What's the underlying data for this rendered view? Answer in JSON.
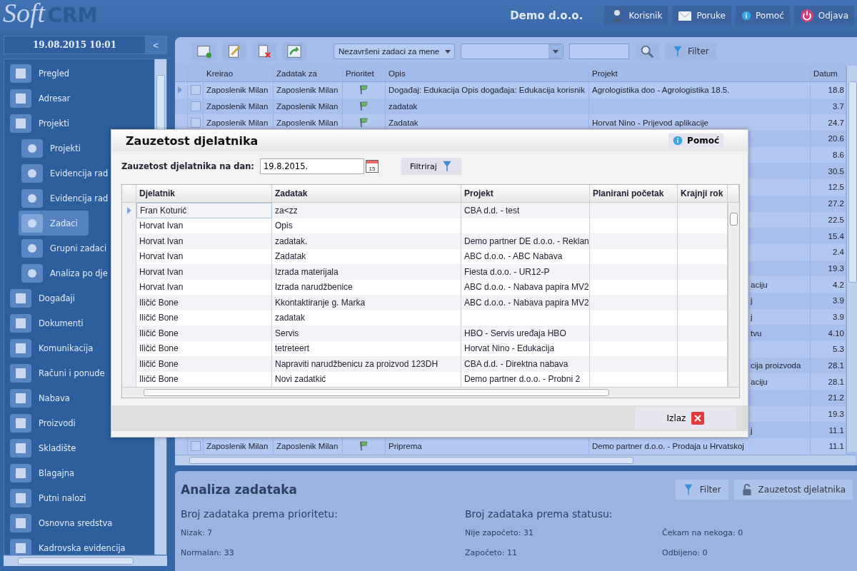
{
  "header": {
    "logo_script": "Soft",
    "logo_bold": "CRM",
    "company": "Demo d.o.o.",
    "buttons": [
      {
        "label": "Korisnik",
        "kind": "user"
      },
      {
        "label": "Poruke",
        "kind": "mail"
      },
      {
        "label": "Pomoć",
        "kind": "info"
      },
      {
        "label": "Odjava",
        "kind": "power"
      }
    ]
  },
  "sidebar": {
    "datetime": "19.08.2015 10:01",
    "collapse": "<",
    "items": [
      {
        "label": "Pregled",
        "selected": false
      },
      {
        "label": "Adresar",
        "selected": false
      },
      {
        "label": "Projekti",
        "selected": false,
        "children": [
          {
            "label": "Projekti",
            "selected": false
          },
          {
            "label": "Evidencija rad",
            "selected": false
          },
          {
            "label": "Evidencija rad",
            "selected": false
          },
          {
            "label": "Zadaci",
            "selected": true
          },
          {
            "label": "Grupni zadaci",
            "selected": false
          },
          {
            "label": "Analiza po dje",
            "selected": false
          }
        ]
      },
      {
        "label": "Događaji",
        "selected": false
      },
      {
        "label": "Dokumenti",
        "selected": false
      },
      {
        "label": "Komunikacija",
        "selected": false
      },
      {
        "label": "Računi i ponude",
        "selected": false
      },
      {
        "label": "Nabava",
        "selected": false
      },
      {
        "label": "Proizvodi",
        "selected": false
      },
      {
        "label": "Skladište",
        "selected": false
      },
      {
        "label": "Blagajna",
        "selected": false
      },
      {
        "label": "Putni nalozi",
        "selected": false
      },
      {
        "label": "Osnovna sredstva",
        "selected": false
      },
      {
        "label": "Kadrovska evidencija",
        "selected": false
      }
    ]
  },
  "toolbar": {
    "view_select": "Nezavršeni zadaci za mene",
    "filter_button": "Filter"
  },
  "tasks": {
    "columns": [
      "Kreirao",
      "Zadatak za",
      "Prioritet",
      "Opis",
      "Projekt",
      "Datum"
    ],
    "rows": [
      {
        "selected": true,
        "checked": false,
        "creator": "Zaposlenik Milan",
        "assignee": "Zaposlenik Milan",
        "description": "Događaj: Edukacija Opis događaja: Edukacija korisnik",
        "project": "Agrologistika doo - Agrologistika 18.5.",
        "date": "18.8"
      },
      {
        "selected": false,
        "checked": false,
        "creator": "Zaposlenik Milan",
        "assignee": "Zaposlenik Milan",
        "description": "zadatak",
        "date": "3.7"
      },
      {
        "selected": false,
        "checked": false,
        "creator": "Zaposlenik Milan",
        "assignee": "Zaposlenik Milan",
        "description": "Zadatak",
        "project": "Horvat Nino - Prijevod aplikacije",
        "date": "24.7"
      },
      {
        "date": "20.6"
      },
      {
        "date": "8.6"
      },
      {
        "date": "30.5"
      },
      {
        "date": "12.5"
      },
      {
        "date": "27.2"
      },
      {
        "date": "22.5"
      },
      {
        "date": "15.4"
      },
      {
        "date": "2.4"
      },
      {
        "date": "19.3"
      },
      {
        "project_tail": "aciju",
        "date": "4.2"
      },
      {
        "project_tail": "j",
        "date": "3.9"
      },
      {
        "project_tail": "j",
        "date": "3.9"
      },
      {
        "project_tail": "tvu",
        "date": "4.10"
      },
      {
        "date": "5.3"
      },
      {
        "project_tail": "cija proizvoda",
        "date": "28.1"
      },
      {
        "project_tail": "aciju",
        "date": "28.1"
      },
      {
        "date": "21.2"
      },
      {
        "date": "19.3"
      },
      {
        "project_tail": "j",
        "date": "11.1"
      },
      {
        "selected": false,
        "checked": false,
        "creator": "Zaposlenik Milan",
        "assignee": "Zaposlenik Milan",
        "description": "Priprema",
        "project": "Demo partner d.o.o. - Prodaja u Hrvatskoj",
        "date": "11.1"
      }
    ]
  },
  "analysis": {
    "title": "Analiza zadataka",
    "buttons": [
      {
        "label": "Filter",
        "kind": "filter"
      },
      {
        "label": "Zauzetost djelatnika",
        "kind": "lock"
      }
    ],
    "groups": [
      {
        "heading": "Broj zadataka prema prioritetu:",
        "lines": [
          "Nizak: 7",
          "Normalan: 33"
        ]
      },
      {
        "heading": "Broj zadataka prema statusu:",
        "lines": [
          "Nije započeto: 31",
          "Započeto: 11"
        ]
      },
      {
        "lines": [
          "Čekam na nekoga: 0",
          "Odbijeno: 0"
        ]
      }
    ]
  },
  "dialog": {
    "title": "Zauzetost djelatnika",
    "help": "Pomoć",
    "date_label": "Zauzetost djelatnika na dan:",
    "date_value": "19.8.2015.",
    "calendar_day": "15",
    "filter_button": "Filtriraj",
    "columns": [
      "Djelatnik",
      "Zadatak",
      "Projekt",
      "Planirani početak",
      "Krajnji rok"
    ],
    "rows": [
      {
        "selected": true,
        "employee": "Fran Koturić",
        "task": "za<zz",
        "project": "CBA d.d. - test"
      },
      {
        "selected": false,
        "employee": "Horvat Ivan",
        "task": "Opis"
      },
      {
        "selected": false,
        "employee": "Horvat Ivan",
        "task": "zadatak.",
        "project": "Demo partner DE d.o.o. - Reklan"
      },
      {
        "selected": false,
        "employee": "Horvat Ivan",
        "task": "Zadatak",
        "project": "ABC d.o.o. - ABC Nabava"
      },
      {
        "selected": false,
        "employee": "Horvat Ivan",
        "task": "Izrada materijala",
        "project": "Fiesta d.o.o. - UR12-P"
      },
      {
        "selected": false,
        "employee": "Horvat Ivan",
        "task": "Izrada narudžbenice",
        "project": "ABC d.o.o. - Nabava papira MV2"
      },
      {
        "selected": false,
        "employee": "Iličić  Bone",
        "task": "Kkontaktiranje g. Marka",
        "project": "ABC d.o.o. - Nabava papira MV2"
      },
      {
        "selected": false,
        "employee": "Iličić  Bone",
        "task": "zadatak"
      },
      {
        "selected": false,
        "employee": "Iličić  Bone",
        "task": "Servis",
        "project": "HBO - Servis uređaja HBO"
      },
      {
        "selected": false,
        "employee": "Iličić  Bone",
        "task": "tetreteert",
        "project": "Horvat Nino - Edukacija"
      },
      {
        "selected": false,
        "employee": "Iličić  Bone",
        "task": "Napraviti narudžbenicu za proizvod 123DH",
        "project": "CBA d.d. - Direktna nabava"
      },
      {
        "selected": false,
        "employee": "Iličić  Bone",
        "task": "Novi zadatkić",
        "project": "Demo partner d.o.o. - Probni 2"
      }
    ],
    "exit_button": "Izlaz"
  }
}
